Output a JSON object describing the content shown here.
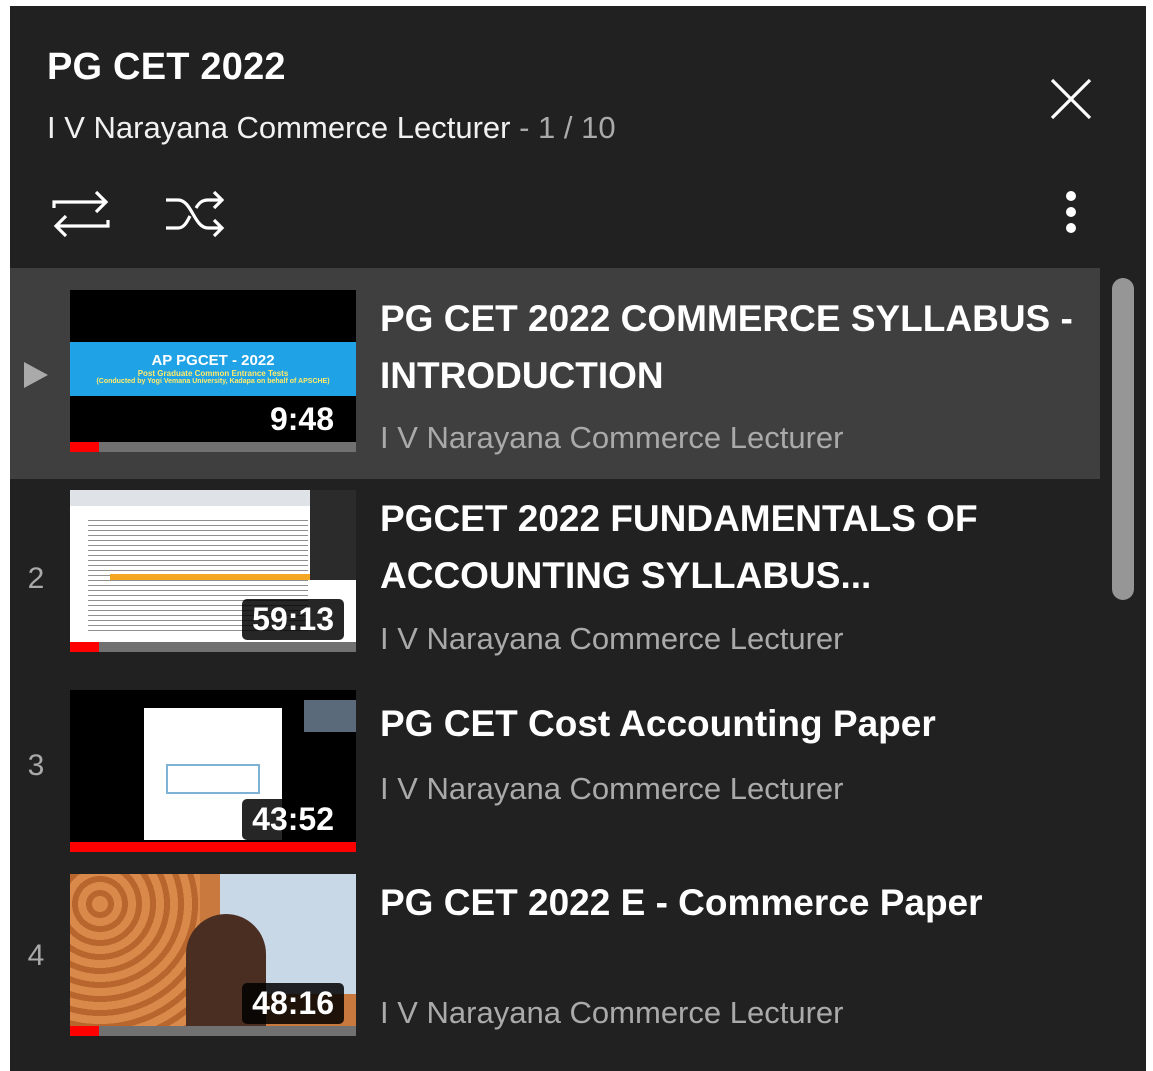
{
  "playlist": {
    "title": "PG CET 2022",
    "channel": "I V Narayana Commerce Lecturer",
    "position_text": " - 1 / 10"
  },
  "controls": {
    "loop_icon": "loop-icon",
    "shuffle_icon": "shuffle-icon",
    "menu_icon": "more-vert-icon",
    "close_icon": "close-icon"
  },
  "items": [
    {
      "index": "",
      "active": true,
      "title": "PG CET 2022 COMMERCE SYLLABUS - INTRODUCTION",
      "channel": "I V Narayana Commerce Lecturer",
      "duration": "9:48",
      "progress": 0.1,
      "thumb_banner_title": "AP PGCET - 2022",
      "thumb_banner_sub1": "Post Graduate Common Entrance Tests",
      "thumb_banner_sub2": "(Conducted by Yogi Vemana University, Kadapa on behalf of APSCHE)"
    },
    {
      "index": "2",
      "active": false,
      "title": "PGCET 2022 FUNDAMENTALS OF ACCOUNTING SYLLABUS...",
      "channel": "I V Narayana Commerce Lecturer",
      "duration": "59:13",
      "progress": 0.1
    },
    {
      "index": "3",
      "active": false,
      "title": "PG CET Cost Accounting Paper",
      "channel": "I V Narayana Commerce Lecturer",
      "duration": "43:52",
      "progress": 1.0
    },
    {
      "index": "4",
      "active": false,
      "title": "PG CET 2022 E - Commerce Paper",
      "channel": "I V Narayana Commerce Lecturer",
      "duration": "48:16",
      "progress": 0.1
    }
  ],
  "colors": {
    "panel_bg": "#212121",
    "active_row_bg": "#3f3f3f",
    "progress_red": "#ff0000",
    "muted_text": "#aaaaaa"
  }
}
